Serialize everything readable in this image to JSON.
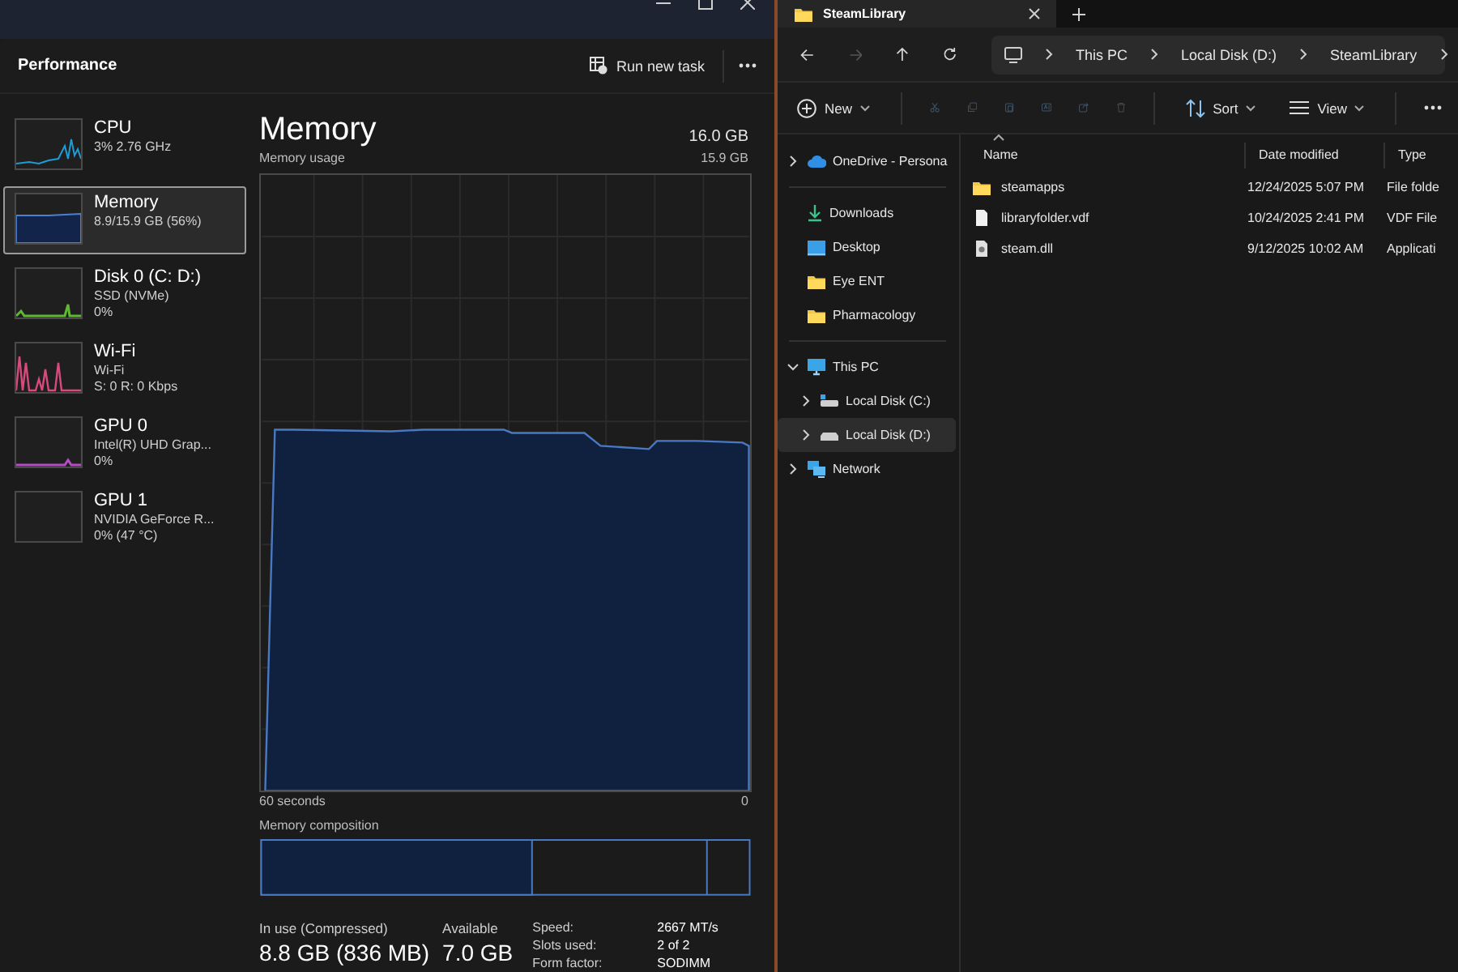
{
  "task_manager": {
    "header": {
      "title": "Performance",
      "run_task_label": "Run new task"
    },
    "sidebar": {
      "items": [
        {
          "kind": "cpu",
          "name": "CPU",
          "lines": [
            "3%  2.76 GHz"
          ],
          "color": "#1f9bd6",
          "selected": false
        },
        {
          "kind": "memory",
          "name": "Memory",
          "lines": [
            "8.9/15.9 GB (56%)"
          ],
          "color": "#4c7fd0",
          "selected": true
        },
        {
          "kind": "disk",
          "name": "Disk 0 (C: D:)",
          "lines": [
            "SSD (NVMe)",
            "0%"
          ],
          "color": "#5fb832",
          "selected": false
        },
        {
          "kind": "network",
          "name": "Wi-Fi",
          "lines": [
            "Wi-Fi",
            "S: 0 R: 0 Kbps"
          ],
          "color": "#d84a7e",
          "selected": false
        },
        {
          "kind": "gpu",
          "name": "GPU 0",
          "lines": [
            "Intel(R) UHD Grap...",
            "0%"
          ],
          "color": "#b64bc4",
          "selected": false
        },
        {
          "kind": "gpu_idle",
          "name": "GPU 1",
          "lines": [
            "NVIDIA GeForce R...",
            "0%  (47 °C)"
          ],
          "selected": false
        }
      ]
    },
    "detail": {
      "title": "Memory",
      "capacity": "16.0 GB",
      "graph_label": "Memory usage",
      "graph_max": "15.9 GB",
      "time_span": "60 seconds",
      "time_end": "0",
      "composition_label": "Memory composition",
      "stats": [
        {
          "label": "In use (Compressed)",
          "value": "8.8 GB (836 MB)"
        },
        {
          "label": "Available",
          "value": "7.0 GB"
        }
      ],
      "properties": [
        {
          "label": "Speed:",
          "value": "2667 MT/s"
        },
        {
          "label": "Slots used:",
          "value": "2 of 2"
        },
        {
          "label": "Form factor:",
          "value": "SODIMM"
        }
      ]
    }
  },
  "explorer": {
    "tabs": [
      {
        "label": "SteamLibrary",
        "selected": true
      }
    ],
    "nav_buttons": [
      {
        "kind": "back",
        "disabled": false
      },
      {
        "kind": "forward",
        "disabled": true
      },
      {
        "kind": "up",
        "disabled": false
      },
      {
        "kind": "refresh",
        "disabled": false
      }
    ],
    "breadcrumb": [
      "This PC",
      "Local Disk (D:)",
      "SteamLibrary"
    ],
    "toolbar": {
      "new_label": "New",
      "actions": [
        {
          "kind": "cut",
          "disabled": true
        },
        {
          "kind": "copy",
          "disabled": true
        },
        {
          "kind": "paste",
          "disabled": true
        },
        {
          "kind": "rename",
          "disabled": true
        },
        {
          "kind": "share",
          "disabled": true
        },
        {
          "kind": "delete",
          "disabled": true
        }
      ],
      "sort_label": "Sort",
      "view_label": "View"
    },
    "nav_pane": {
      "sections": [
        {
          "items": [
            {
              "kind": "cloud",
              "label": "OneDrive - Persona",
              "expanded": false,
              "selected": false
            }
          ]
        },
        {
          "items": [
            {
              "kind": "download",
              "label": "Downloads",
              "selected": false
            },
            {
              "kind": "desktop",
              "label": "Desktop",
              "selected": false
            },
            {
              "kind": "folder",
              "label": "Eye ENT",
              "selected": false
            },
            {
              "kind": "folder",
              "label": "Pharmacology",
              "selected": false
            }
          ]
        },
        {
          "items": [
            {
              "kind": "pc",
              "label": "This PC",
              "expanded": true,
              "selected": false,
              "children": [
                {
                  "kind": "drive_c",
                  "label": "Local Disk (C:)",
                  "expanded": false,
                  "selected": false
                },
                {
                  "kind": "drive",
                  "label": "Local Disk (D:)",
                  "expanded": false,
                  "selected": true
                }
              ]
            },
            {
              "kind": "network",
              "label": "Network",
              "expanded": false,
              "selected": false
            }
          ]
        }
      ]
    },
    "files": {
      "columns": [
        "Name",
        "Date modified",
        "Type"
      ],
      "rows": [
        {
          "kind": "folder",
          "name": "steamapps",
          "date": "12/24/2025 5:07 PM",
          "type": "File folde"
        },
        {
          "kind": "file",
          "name": "libraryfolder.vdf",
          "date": "10/24/2025 2:41 PM",
          "type": "VDF File"
        },
        {
          "kind": "dll",
          "name": "steam.dll",
          "date": "9/12/2025 10:02 AM",
          "type": "Applicati"
        }
      ]
    }
  }
}
